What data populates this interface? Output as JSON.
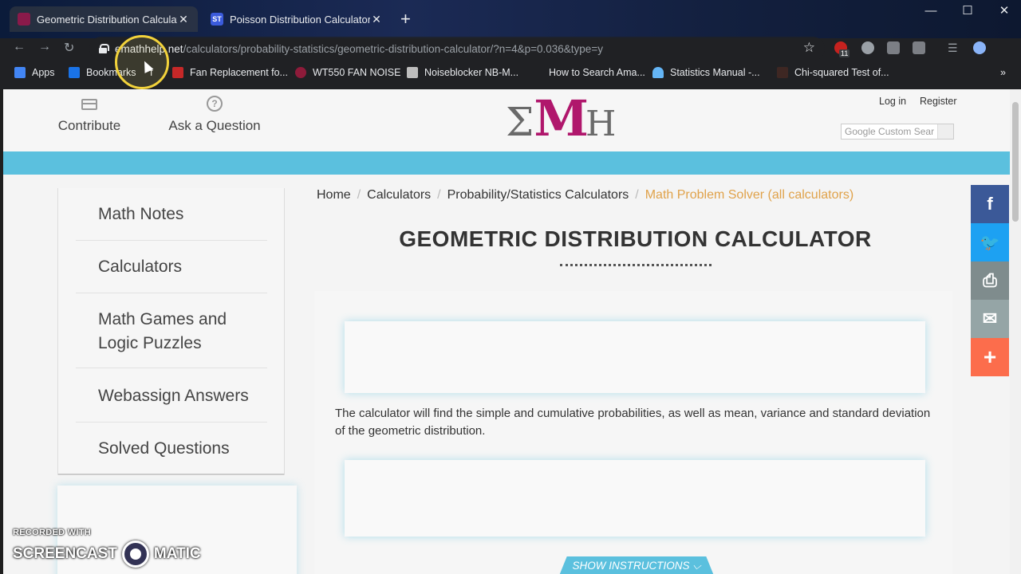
{
  "browser": {
    "tabs": [
      {
        "title": "Geometric Distribution Calculato",
        "favicon": "emathhelp-favicon",
        "active": true
      },
      {
        "title": "Poisson Distribution Calculator",
        "favicon": "ST",
        "active": false
      }
    ],
    "new_tab": "+",
    "window_controls": {
      "minimize": "—",
      "maximize": "☐",
      "close": "✕"
    },
    "url": {
      "host": "emathhelp.net",
      "path": "/calculators/probability-statistics/geometric-distribution-calculator/?n=4&p=0.036&type=y"
    },
    "extension_badge": "11",
    "bookmarks": [
      {
        "label": "Apps"
      },
      {
        "label": "Bookmarks"
      },
      {
        "label": "f"
      },
      {
        "label": "Fan Replacement fo..."
      },
      {
        "label": "WT550 FAN NOISE"
      },
      {
        "label": "Noiseblocker NB-M..."
      },
      {
        "label": "How to Search Ama..."
      },
      {
        "label": "Statistics Manual -..."
      },
      {
        "label": "Chi-squared Test of..."
      }
    ],
    "bookmarks_more": "»"
  },
  "site": {
    "header": {
      "contribute": "Contribute",
      "ask_question": "Ask a Question",
      "logo": {
        "sigma": "Σ",
        "m": "M",
        "h": "H"
      },
      "login": "Log in",
      "register": "Register",
      "search_placeholder": "Custom Sear",
      "search_brand": "Google"
    },
    "sidebar": [
      {
        "label": "Math Notes"
      },
      {
        "label": "Calculators"
      },
      {
        "label": "Math Games and Logic Puzzles"
      },
      {
        "label": "Webassign Answers"
      },
      {
        "label": "Solved Questions"
      }
    ],
    "breadcrumbs": [
      {
        "label": "Home"
      },
      {
        "label": "Calculators"
      },
      {
        "label": "Probability/Statistics Calculators"
      },
      {
        "label": "Math Problem Solver (all calculators)"
      }
    ],
    "breadcrumb_separator": "/",
    "title": "GEOMETRIC DISTRIBUTION CALCULATOR",
    "description": "The calculator will find the simple and cumulative probabilities, as well as mean, variance and standard deviation of the geometric distribution.",
    "show_instructions": "SHOW INSTRUCTIONS ⌵",
    "share": [
      {
        "icon": "facebook-icon",
        "glyph": "f",
        "color": "#3b5998"
      },
      {
        "icon": "twitter-icon",
        "glyph": "🐦",
        "color": "#1da1f2"
      },
      {
        "icon": "print-icon",
        "glyph": "⎙",
        "color": "#7f8c8d"
      },
      {
        "icon": "email-icon",
        "glyph": "✉",
        "color": "#95a5a6"
      },
      {
        "icon": "more-icon",
        "glyph": "+",
        "color": "#fc6d4c"
      }
    ]
  },
  "watermark": {
    "line1": "RECORDED WITH",
    "left": "SCREENCAST",
    "right": "MATIC"
  },
  "colors": {
    "accent_blue": "#5bc0de",
    "logo_magenta": "#b0176c",
    "breadcrumb_current": "#e0a24a"
  }
}
